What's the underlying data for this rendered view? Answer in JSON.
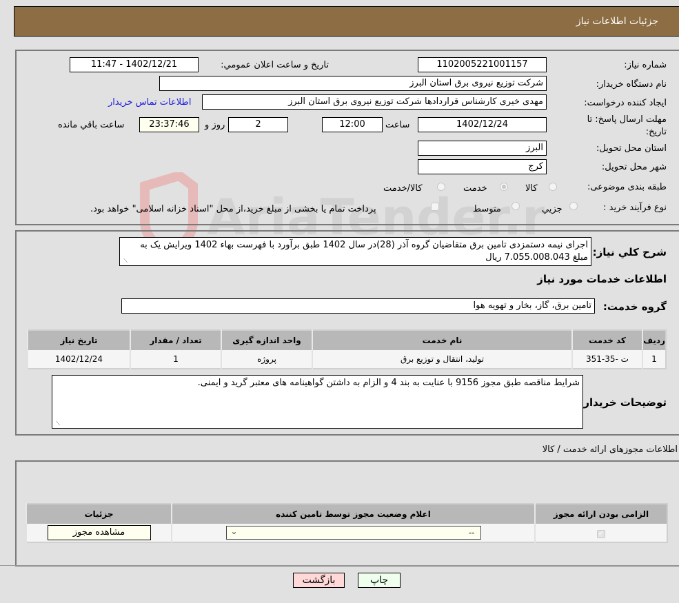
{
  "header": {
    "title": "جزئیات اطلاعات نیاز"
  },
  "form": {
    "need_number": {
      "label": "شماره نیاز:",
      "value": "1102005221001157"
    },
    "announce_datetime": {
      "label": "تاریخ و ساعت اعلان عمومي:",
      "value": "1402/12/21 - 11:47"
    },
    "buyer_org": {
      "label": "نام دستگاه خریدار:",
      "value": "شرکت توزیع نیروی برق استان البرز"
    },
    "requester": {
      "label": "ایجاد کننده درخواست:",
      "value": "مهدی خیری کارشناس قراردادها شرکت توزیع نیروی برق استان البرز",
      "contact_link": "اطلاعات تماس خریدار"
    },
    "deadline": {
      "label_line1": "مهلت ارسال پاسخ: تا",
      "label_line2": "تاریخ:",
      "date": "1402/12/24",
      "time_label": "ساعت",
      "time": "12:00",
      "days": "2",
      "days_label": "روز و",
      "remaining": "23:37:46",
      "remaining_label": "ساعت باقي مانده"
    },
    "province": {
      "label": "استان محل تحویل:",
      "value": "البرز"
    },
    "city": {
      "label": "شهر محل تحویل:",
      "value": "کرج"
    },
    "category": {
      "label": "طبقه بندی موضوعی:",
      "options": [
        {
          "label": "کالا",
          "selected": false
        },
        {
          "label": "خدمت",
          "selected": true
        },
        {
          "label": "کالا/خدمت",
          "selected": false
        }
      ]
    },
    "purchase_type": {
      "label": "نوع فرآیند خرید :",
      "options": [
        {
          "label": "جزيي",
          "selected": false
        },
        {
          "label": "متوسط",
          "selected": false
        }
      ],
      "treasury_note": "پرداخت تمام یا بخشی از مبلغ خرید،از محل \"اسناد خزانه اسلامی\" خواهد بود.",
      "treasury_checked": false
    }
  },
  "description": {
    "label": "شرح کلي نیاز:",
    "value": "اجرای نیمه دستمزدی تامین برق متقاضیان گروه آذر (28)در سال 1402 طبق برآورد با فهرست بهاء 1402 ویرایش یک به مبلغ 7.055.008.043 ریال"
  },
  "services": {
    "section_title": "اطلاعات خدمات مورد نیاز",
    "group_label": "گروه خدمت:",
    "group_value": "تامین برق، گاز، بخار و تهویه هوا",
    "table": {
      "headers": [
        "ردیف",
        "کد خدمت",
        "نام خدمت",
        "واحد اندازه گیری",
        "تعداد / مقدار",
        "تاریخ نیاز"
      ],
      "rows": [
        [
          "1",
          "ت -35-351",
          "تولید، انتقال و توزیع برق",
          "پروژه",
          "1",
          "1402/12/24"
        ]
      ]
    }
  },
  "buyer_notes": {
    "label": "توضیحات خریدار:",
    "value": "شرایط مناقصه طبق مجوز 9156 با عنایت به بند 4 و الزام به داشتن گواهینامه های معتبر گرید و ایمنی."
  },
  "permits": {
    "section_title": "اطلاعات مجوزهای ارائه خدمت / کالا",
    "headers": [
      "الزامی بودن ارائه مجوز",
      "اعلام وضعیت مجوز توسط تامین کننده",
      "جزئیات"
    ],
    "row": {
      "required": true,
      "status_value": "--",
      "details_button": "مشاهده مجوز"
    }
  },
  "footer": {
    "print_button": "چاپ",
    "back_button": "بازگشت"
  },
  "watermark": {
    "text": "AriaTender.neT"
  }
}
